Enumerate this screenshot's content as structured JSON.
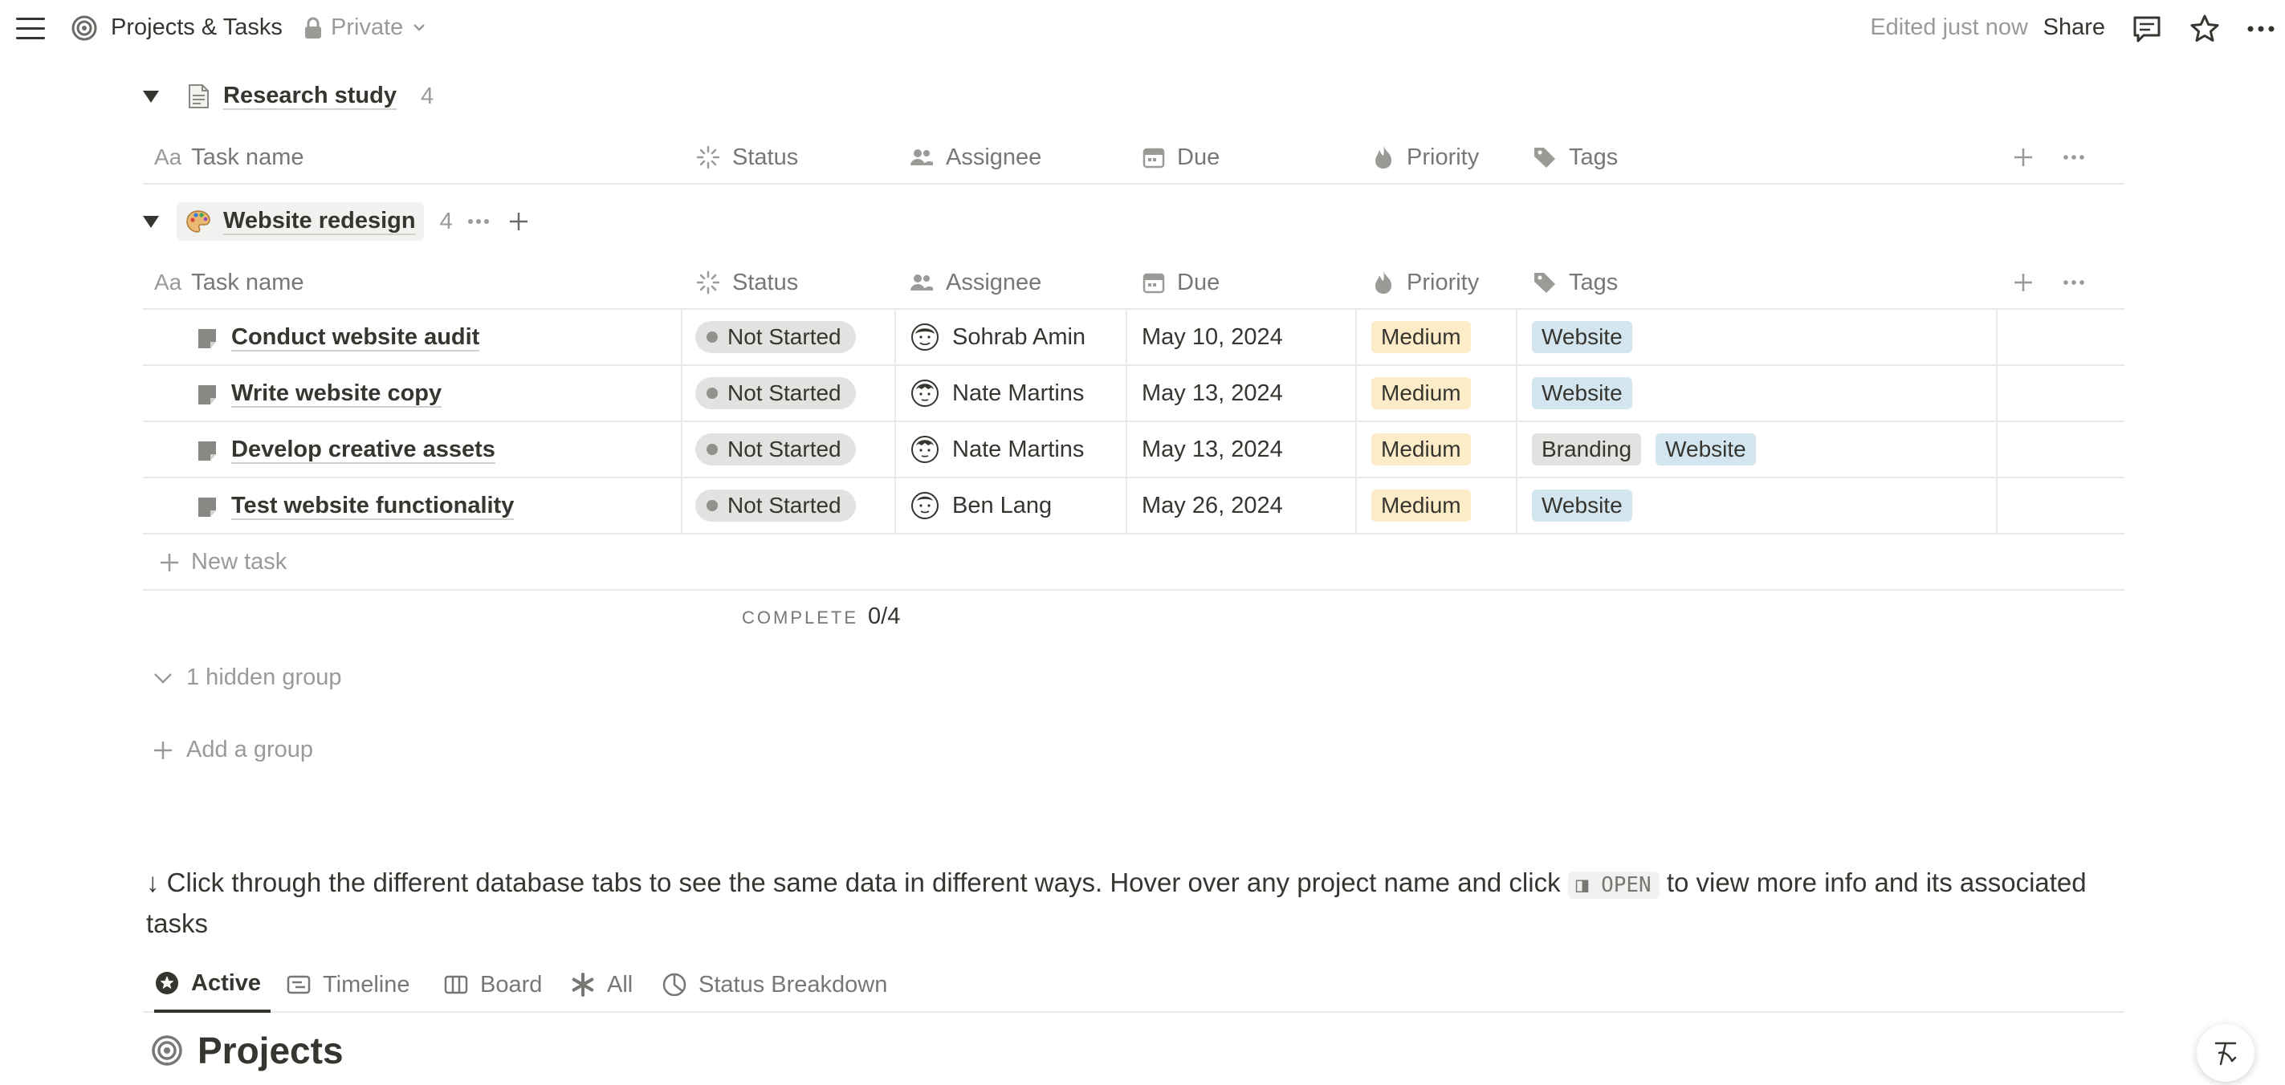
{
  "topbar": {
    "menu_icon": "hamburger-icon",
    "page_icon": "target-icon",
    "title": "Projects & Tasks",
    "privacy_icon": "lock-icon",
    "privacy": "Private",
    "edited": "Edited just now",
    "share": "Share",
    "comments_icon": "comment-icon",
    "favorite_icon": "star-icon",
    "more_icon": "more-icon"
  },
  "columns": {
    "task_name_prefix": "Aa",
    "task_name": "Task name",
    "status": "Status",
    "assignee": "Assignee",
    "due": "Due",
    "priority": "Priority",
    "tags": "Tags"
  },
  "groups": [
    {
      "name": "Research study",
      "count": "4",
      "emoji": "document-emoji",
      "collapsed": false,
      "rows": []
    },
    {
      "name": "Website redesign",
      "count": "4",
      "emoji": "palette-emoji",
      "rows": [
        {
          "task": "Conduct website audit",
          "status": "Not Started",
          "assignee": "Sohrab Amin",
          "due": "May 10, 2024",
          "priority": "Medium",
          "tags": [
            "Website"
          ]
        },
        {
          "task": "Write website copy",
          "status": "Not Started",
          "assignee": "Nate Martins",
          "due": "May 13, 2024",
          "priority": "Medium",
          "tags": [
            "Website"
          ]
        },
        {
          "task": "Develop creative assets",
          "status": "Not Started",
          "assignee": "Nate Martins",
          "due": "May 13, 2024",
          "priority": "Medium",
          "tags": [
            "Branding",
            "Website"
          ]
        },
        {
          "task": "Test website functionality",
          "status": "Not Started",
          "assignee": "Ben Lang",
          "due": "May 26, 2024",
          "priority": "Medium",
          "tags": [
            "Website"
          ]
        }
      ],
      "new_task": "New task",
      "complete_label": "COMPLETE",
      "complete_value": "0/4"
    }
  ],
  "hidden_groups": "1 hidden group",
  "add_group": "Add a group",
  "note": {
    "before": "↓ Click through the different database tabs to see the same data in different ways. Hover over any project name and click",
    "code": "◨ OPEN",
    "after": "to view more info and its associated tasks"
  },
  "tabs": [
    {
      "label": "Active",
      "icon": "star-circle-icon",
      "active": true
    },
    {
      "label": "Timeline",
      "icon": "timeline-icon"
    },
    {
      "label": "Board",
      "icon": "board-icon"
    },
    {
      "label": "All",
      "icon": "asterisk-icon"
    },
    {
      "label": "Status Breakdown",
      "icon": "pie-chart-icon"
    }
  ],
  "projects_heading": "Projects",
  "colors": {
    "status_pill": "#e3e2e0",
    "priority_medium": "#fdecc8",
    "tag_website": "#d3e5ef",
    "tag_branding": "#e3e2e0",
    "muted_text": "#9b9a97"
  }
}
